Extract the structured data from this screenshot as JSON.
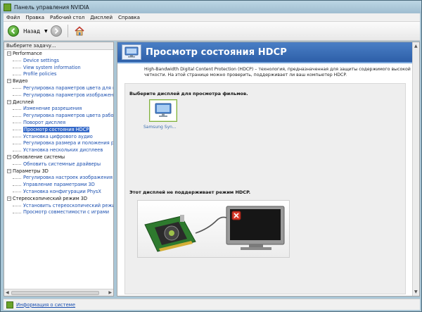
{
  "window": {
    "title": "Панель управления NVIDIA"
  },
  "menu": [
    "Файл",
    "Правка",
    "Рабочий стол",
    "Дисплей",
    "Справка"
  ],
  "toolbar": {
    "back_label": "Назад"
  },
  "left_panel": {
    "header": "Выберите задачу...",
    "tree": [
      {
        "type": "cat",
        "label": "Performance"
      },
      {
        "type": "leaf",
        "label": "Device settings"
      },
      {
        "type": "leaf",
        "label": "View system information"
      },
      {
        "type": "leaf",
        "label": "Profile policies"
      },
      {
        "type": "cat",
        "label": "Видео"
      },
      {
        "type": "leaf",
        "label": "Регулировка параметров цвета для вид"
      },
      {
        "type": "leaf",
        "label": "Регулировка параметров изображения д"
      },
      {
        "type": "cat",
        "label": "Дисплей"
      },
      {
        "type": "leaf",
        "label": "Изменение разрешения"
      },
      {
        "type": "leaf",
        "label": "Регулировка параметров цвета рабочег"
      },
      {
        "type": "leaf",
        "label": "Поворот дисплея"
      },
      {
        "type": "leaf",
        "label": "Просмотр состояния HDCP",
        "selected": true
      },
      {
        "type": "leaf",
        "label": "Установка цифрового аудио"
      },
      {
        "type": "leaf",
        "label": "Регулировка размера и положения рабо"
      },
      {
        "type": "leaf",
        "label": "Установка нескольких дисплеев"
      },
      {
        "type": "cat",
        "label": "Обновление системы"
      },
      {
        "type": "leaf",
        "label": "Обновить системные драйверы"
      },
      {
        "type": "cat",
        "label": "Параметры 3D"
      },
      {
        "type": "leaf",
        "label": "Регулировка настроек изображения с пр"
      },
      {
        "type": "leaf",
        "label": "Управление параметрами 3D"
      },
      {
        "type": "leaf",
        "label": "Установка конфигурации PhysX"
      },
      {
        "type": "cat",
        "label": "Стереоскопический режим 3D"
      },
      {
        "type": "leaf",
        "label": "Установить стереоскопический режим 3"
      },
      {
        "type": "leaf",
        "label": "Просмотр совместимости с играми"
      }
    ]
  },
  "main": {
    "title": "Просмотр состояния HDCP",
    "description": "High-Bandwidth Digital Content Protection (HDCP) – технология, предназначенная для защиты содержимого высокой четкости. На этой странице можно проверить, поддерживает ли ваш компьютер HDCP.",
    "select_display_label": "Выберите дисплей для просмотра фильмов.",
    "display_name": "Samsung Syn...",
    "not_supported_label": "Этот дисплей не поддерживает режим HDCP."
  },
  "status": {
    "link": "Информация о системе"
  }
}
